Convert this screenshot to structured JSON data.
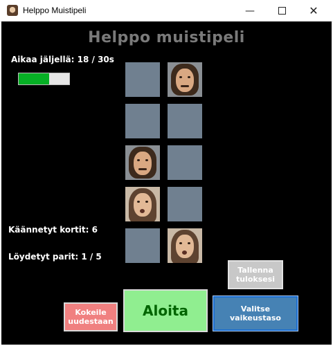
{
  "window": {
    "title": "Helppo Muistipeli",
    "minimize_glyph": "—",
    "close_glyph": "✕"
  },
  "game": {
    "heading": "Helppo muistipeli",
    "time_left": "Aikaa jäljellä: 18 / 30s",
    "time_progress_fraction": 0.6,
    "flipped_cards": "Käännetyt kortit: 6",
    "found_pairs": "Löydetyt parit: 1 / 5"
  },
  "cards": [
    {
      "state": "hidden"
    },
    {
      "state": "revealed",
      "icon": "man-mustache-face"
    },
    {
      "state": "hidden"
    },
    {
      "state": "hidden"
    },
    {
      "state": "revealed",
      "icon": "man-mustache-face"
    },
    {
      "state": "hidden"
    },
    {
      "state": "revealed",
      "icon": "long-hair-face"
    },
    {
      "state": "hidden"
    },
    {
      "state": "hidden"
    },
    {
      "state": "revealed",
      "icon": "long-hair-face"
    }
  ],
  "buttons": {
    "save": "Tallenna tuloksesi",
    "retry": "Kokeile uudestaan",
    "start": "Aloita",
    "difficulty": "Valitse vaikeustaso"
  },
  "colors": {
    "card_back": "#708090",
    "progress_fill": "#06b025",
    "retry_bg": "#f08080",
    "start_bg": "#90ee90",
    "start_text": "#006400",
    "difficulty_bg": "#4682b4",
    "save_bg": "#c8c8c8",
    "heading_text": "#7a7a7a"
  }
}
